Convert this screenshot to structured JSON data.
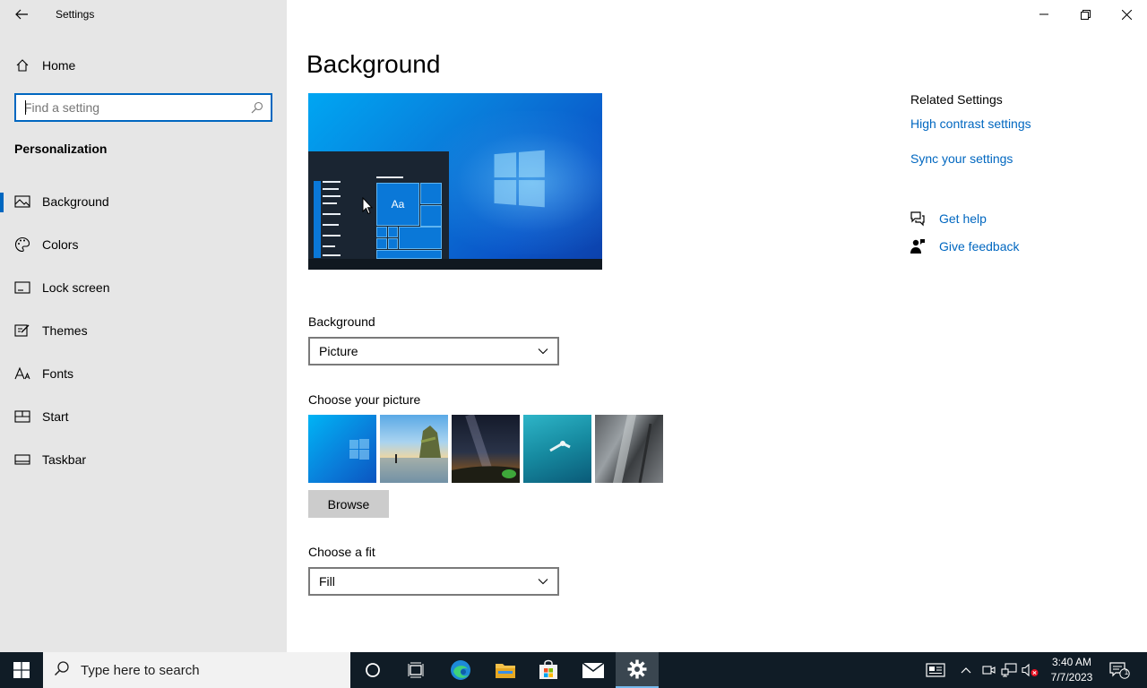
{
  "window": {
    "title": "Settings"
  },
  "sidebar": {
    "home_label": "Home",
    "search_placeholder": "Find a setting",
    "section_title": "Personalization",
    "items": [
      {
        "label": "Background",
        "icon": "picture-icon",
        "selected": true
      },
      {
        "label": "Colors",
        "icon": "palette-icon",
        "selected": false
      },
      {
        "label": "Lock screen",
        "icon": "lock-screen-icon",
        "selected": false
      },
      {
        "label": "Themes",
        "icon": "themes-icon",
        "selected": false
      },
      {
        "label": "Fonts",
        "icon": "fonts-icon",
        "selected": false
      },
      {
        "label": "Start",
        "icon": "start-icon",
        "selected": false
      },
      {
        "label": "Taskbar",
        "icon": "taskbar-icon",
        "selected": false
      }
    ]
  },
  "main": {
    "page_title": "Background",
    "preview_sample_text": "Aa",
    "background_label": "Background",
    "background_value": "Picture",
    "choose_picture_label": "Choose your picture",
    "browse_label": "Browse",
    "fit_label": "Choose a fit",
    "fit_value": "Fill"
  },
  "related": {
    "title": "Related Settings",
    "links": [
      "High contrast settings",
      "Sync your settings"
    ],
    "get_help": "Get help",
    "give_feedback": "Give feedback"
  },
  "taskbar": {
    "search_placeholder": "Type here to search",
    "time": "3:40 AM",
    "date": "7/7/2023",
    "notification_count": "1"
  },
  "colors": {
    "accent": "#0067c0",
    "sidebar_bg": "#e6e6e6",
    "taskbar_bg": "#101c26"
  }
}
